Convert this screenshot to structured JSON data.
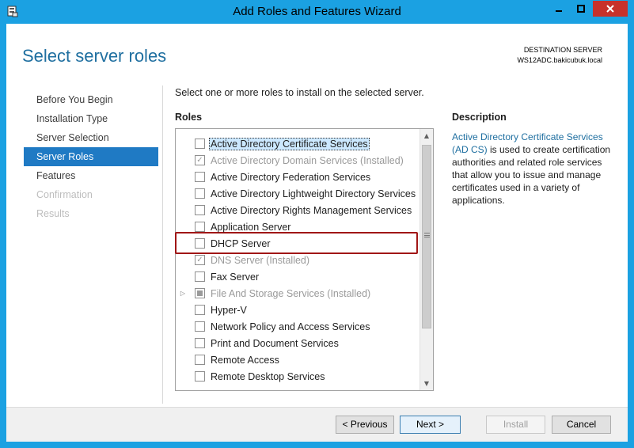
{
  "window": {
    "title": "Add Roles and Features Wizard",
    "accent_color": "#1ba1e2",
    "close_color": "#c7312b"
  },
  "header": {
    "title": "Select server roles",
    "destination_label": "DESTINATION SERVER",
    "destination_server": "WS12ADC.bakicubuk.local"
  },
  "nav": {
    "items": [
      {
        "label": "Before You Begin",
        "state": "normal"
      },
      {
        "label": "Installation Type",
        "state": "normal"
      },
      {
        "label": "Server Selection",
        "state": "normal"
      },
      {
        "label": "Server Roles",
        "state": "active"
      },
      {
        "label": "Features",
        "state": "normal"
      },
      {
        "label": "Confirmation",
        "state": "disabled"
      },
      {
        "label": "Results",
        "state": "disabled"
      }
    ]
  },
  "main": {
    "instruction": "Select one or more roles to install on the selected server.",
    "roles_heading": "Roles",
    "roles": [
      {
        "label": "Active Directory Certificate Services",
        "checked": false,
        "selected": true
      },
      {
        "label": "Active Directory Domain Services (Installed)",
        "checked": true,
        "disabled": true
      },
      {
        "label": "Active Directory Federation Services",
        "checked": false
      },
      {
        "label": "Active Directory Lightweight Directory Services",
        "checked": false
      },
      {
        "label": "Active Directory Rights Management Services",
        "checked": false
      },
      {
        "label": "Application Server",
        "checked": false
      },
      {
        "label": "DHCP Server",
        "checked": false
      },
      {
        "label": "DNS Server (Installed)",
        "checked": true,
        "disabled": true
      },
      {
        "label": "Fax Server",
        "checked": false
      },
      {
        "label": "File And Storage Services (Installed)",
        "mixed": true,
        "disabled": true,
        "expandable": true
      },
      {
        "label": "Hyper-V",
        "checked": false
      },
      {
        "label": "Network Policy and Access Services",
        "checked": false
      },
      {
        "label": "Print and Document Services",
        "checked": false
      },
      {
        "label": "Remote Access",
        "checked": false
      },
      {
        "label": "Remote Desktop Services",
        "checked": false
      }
    ]
  },
  "description": {
    "heading": "Description",
    "link_text": "Active Directory Certificate Services (AD CS)",
    "body": " is used to create certification authorities and related role services that allow you to issue and manage certificates used in a variety of applications."
  },
  "footer": {
    "previous_label": "< Previous",
    "next_label": "Next >",
    "install_label": "Install",
    "cancel_label": "Cancel"
  }
}
